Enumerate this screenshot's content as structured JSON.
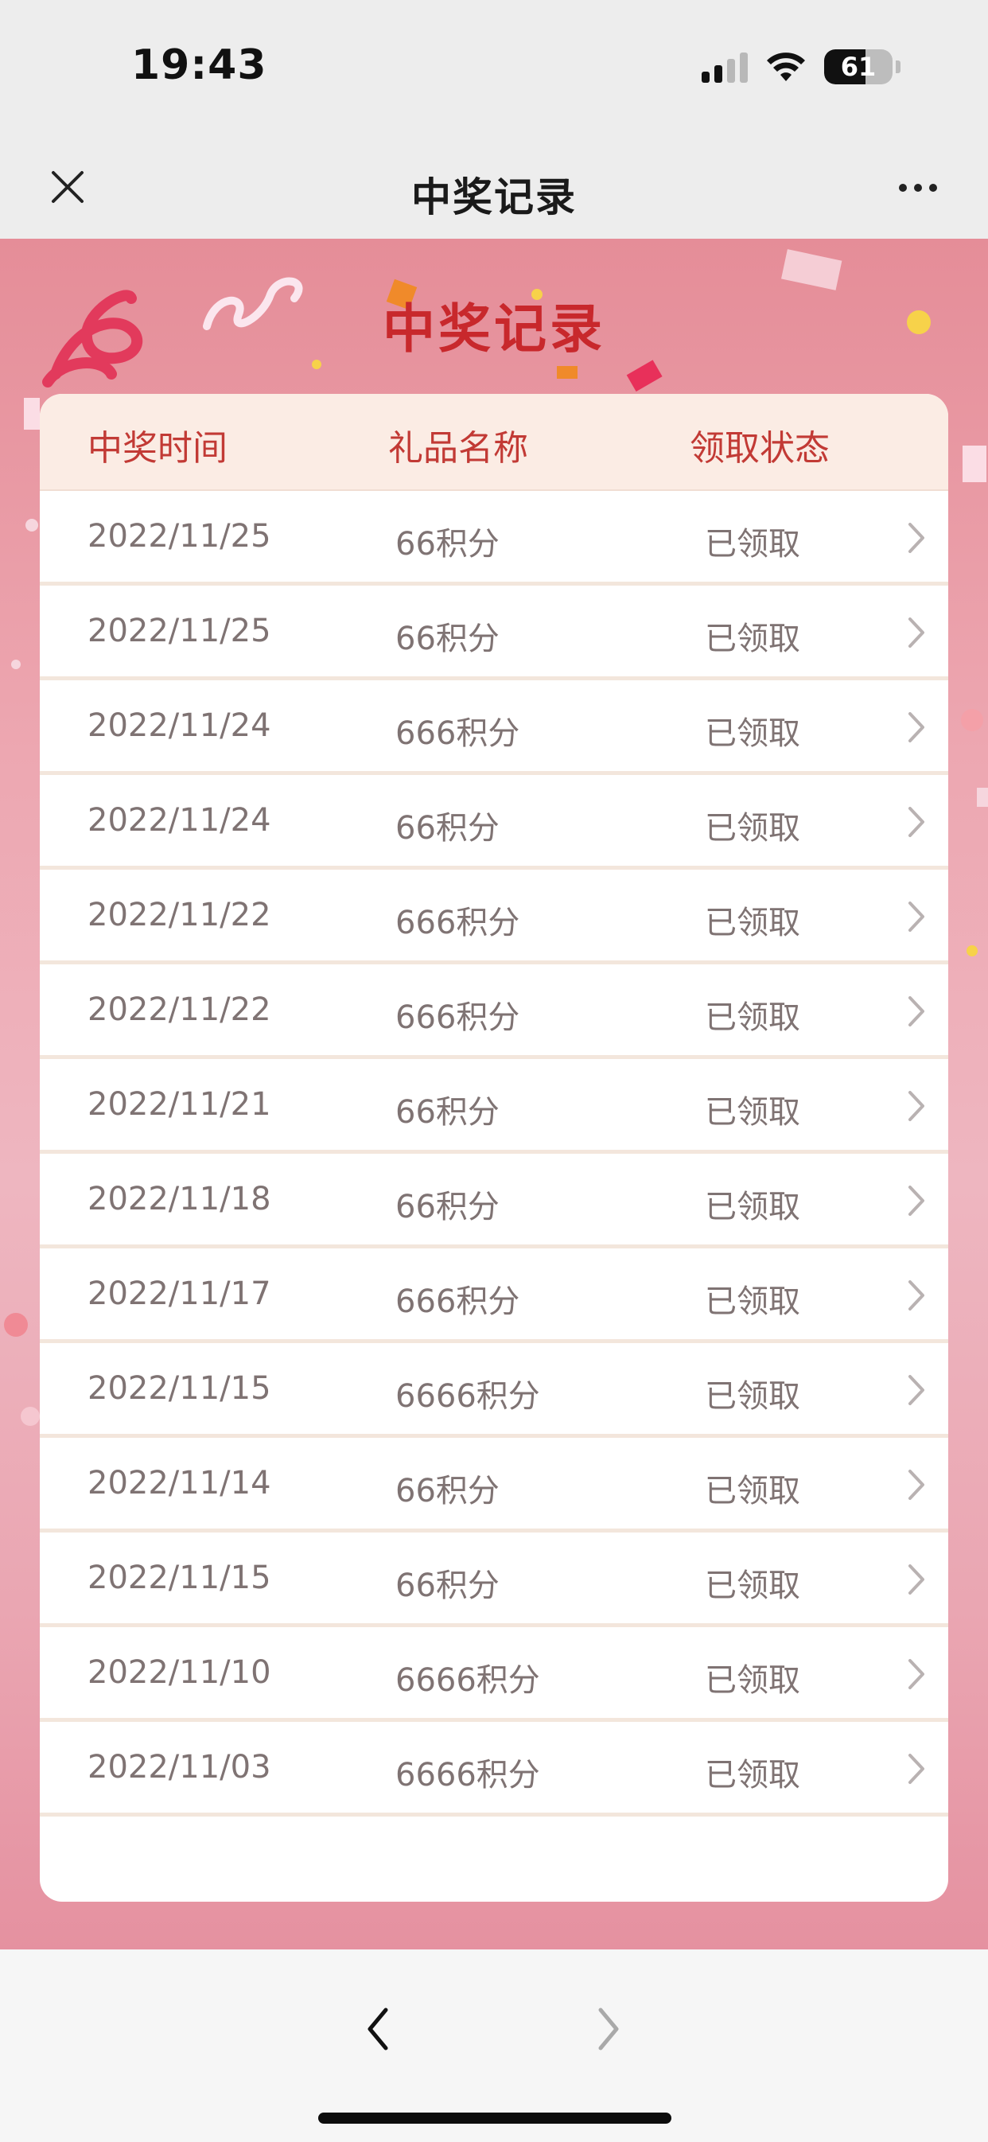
{
  "status": {
    "time": "19:43",
    "battery_level": 61,
    "battery_text": "61",
    "signal_bars_active": 2
  },
  "nav": {
    "title": "中奖记录",
    "close_icon": "close-icon",
    "more_icon": "more-icon"
  },
  "banner": {
    "title": "中奖记录"
  },
  "table": {
    "headers": [
      "中奖时间",
      "礼品名称",
      "领取状态"
    ],
    "rows": [
      {
        "date": "2022/11/25",
        "gift": "66积分",
        "status": "已领取"
      },
      {
        "date": "2022/11/25",
        "gift": "66积分",
        "status": "已领取"
      },
      {
        "date": "2022/11/24",
        "gift": "666积分",
        "status": "已领取"
      },
      {
        "date": "2022/11/24",
        "gift": "66积分",
        "status": "已领取"
      },
      {
        "date": "2022/11/22",
        "gift": "666积分",
        "status": "已领取"
      },
      {
        "date": "2022/11/22",
        "gift": "666积分",
        "status": "已领取"
      },
      {
        "date": "2022/11/21",
        "gift": "66积分",
        "status": "已领取"
      },
      {
        "date": "2022/11/18",
        "gift": "66积分",
        "status": "已领取"
      },
      {
        "date": "2022/11/17",
        "gift": "666积分",
        "status": "已领取"
      },
      {
        "date": "2022/11/15",
        "gift": "6666积分",
        "status": "已领取"
      },
      {
        "date": "2022/11/14",
        "gift": "66积分",
        "status": "已领取"
      },
      {
        "date": "2022/11/15",
        "gift": "66积分",
        "status": "已领取"
      },
      {
        "date": "2022/11/10",
        "gift": "6666积分",
        "status": "已领取"
      },
      {
        "date": "2022/11/03",
        "gift": "6666积分",
        "status": "已领取"
      }
    ]
  },
  "bottom": {
    "back_icon": "chevron-left-icon",
    "forward_icon": "chevron-right-icon"
  },
  "colors": {
    "accent_red": "#c8282c",
    "header_text": "#c23a35",
    "cell_text": "#7f7373",
    "header_bg": "#fbece4"
  }
}
